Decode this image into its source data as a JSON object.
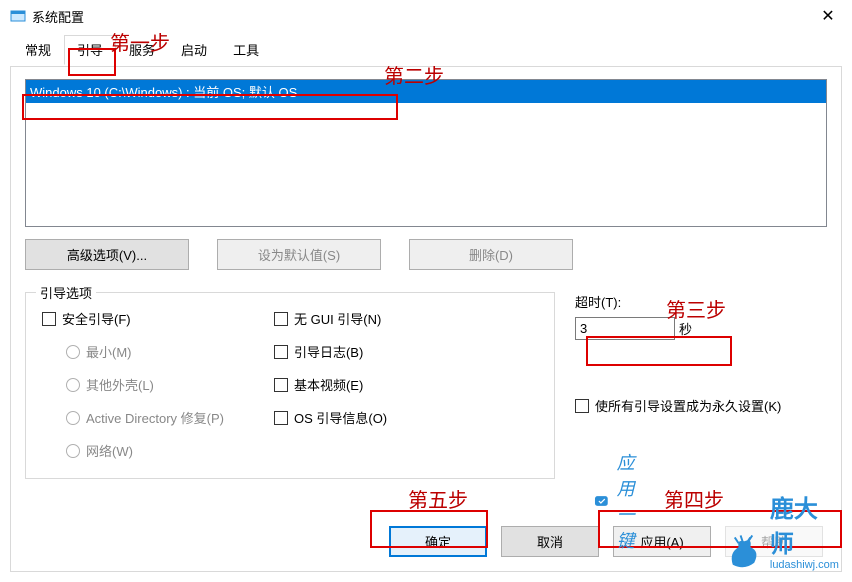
{
  "window": {
    "title": "系统配置",
    "close_aria": "Close"
  },
  "tabs": {
    "general": "常规",
    "boot": "引导",
    "services": "服务",
    "startup": "启动",
    "tools": "工具"
  },
  "os_list": {
    "item0": "Windows 10 (C:\\Windows) : 当前 OS; 默认 OS"
  },
  "buttons": {
    "advanced": "高级选项(V)...",
    "set_default": "设为默认值(S)",
    "delete": "删除(D)",
    "ok": "确定",
    "cancel": "取消",
    "apply": "应用(A)",
    "help": "帮助"
  },
  "boot_options": {
    "group_title": "引导选项",
    "safe_boot": "安全引导(F)",
    "minimal": "最小(M)",
    "alt_shell": "其他外壳(L)",
    "ad_repair": "Active Directory 修复(P)",
    "network": "网络(W)",
    "no_gui": "无 GUI 引导(N)",
    "boot_log": "引导日志(B)",
    "base_video": "基本视频(E)",
    "os_boot_info": "OS 引导信息(O)"
  },
  "timeout": {
    "label": "超时(T):",
    "value": "3",
    "unit": "秒"
  },
  "permanent": {
    "label": "使所有引导设置成为永久设置(K)"
  },
  "annotations": {
    "step1": "第一步",
    "step2": "第二步",
    "step3": "第三步",
    "step4": "第四步",
    "step5": "第五步"
  },
  "watermark": {
    "cloud_text": "应用一键",
    "brand": "鹿大师",
    "url": "ludashiwj.com"
  }
}
